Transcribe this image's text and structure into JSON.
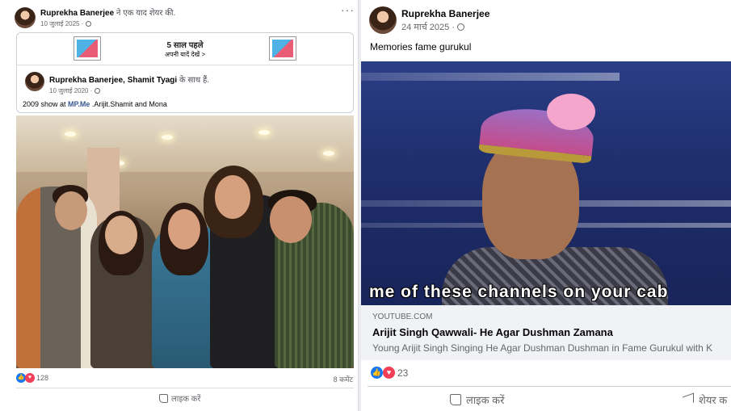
{
  "left_post": {
    "author": "Ruprekha Banerjee",
    "action": " ने एक याद शेयर की.",
    "date": "10 जुलाई 2025 ·",
    "more": "···",
    "memory": {
      "title": "5 साल पहले",
      "link": "अपनी यादें देखें >"
    },
    "shared": {
      "authors": "Ruprekha Banerjee, Shamit Tyagi",
      "with": " के साथ हैं.",
      "date": "10 जुलाई 2020 ·"
    },
    "caption_prefix": "2009 show at ",
    "caption_link": "MP.Me",
    "caption_suffix": " .Arijit.Shamit and Mona",
    "reactions": "128",
    "comments": "8 कमेंट",
    "like_label": "लाइक करें"
  },
  "right_post": {
    "author": "Ruprekha Banerjee",
    "date": "24 मार्च 2025 ·",
    "text": "Memories fame gurukul",
    "video_subtitle": "me of these channels on your cab",
    "link_domain": "YOUTUBE.COM",
    "link_title": "Arijit Singh Qawwali- He Agar Dushman Zamana",
    "link_desc": "Young Arijit Singh Singing He Agar Dushman Dushman in Fame Gurukul with K",
    "reactions": "23",
    "like_label": "लाइक करें",
    "share_label": "शेयर क"
  },
  "icons": {
    "like": "like-icon",
    "love": "love-icon",
    "globe": "globe-icon"
  },
  "colors": {
    "link": "#385898",
    "like_blue": "#1877f2",
    "love_red": "#f33e58"
  }
}
